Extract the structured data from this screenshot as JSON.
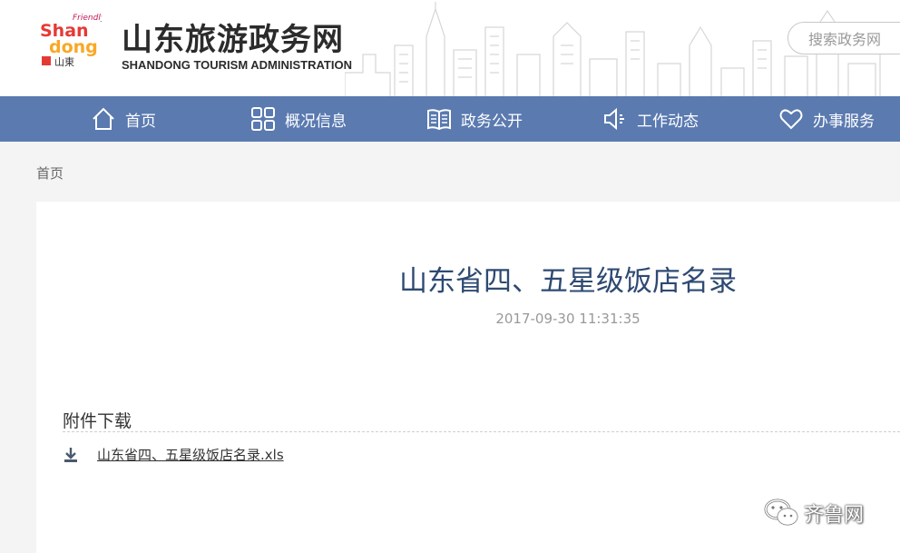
{
  "header": {
    "logo_text": "Shandong",
    "logo_script": "Friendly",
    "site_title": "山东旅游政务网",
    "site_subtitle": "SHANDONG TOURISM ADMINISTRATION",
    "search_placeholder": "搜索政务网"
  },
  "nav": {
    "items": [
      {
        "label": "首页",
        "icon": "home-icon"
      },
      {
        "label": "概况信息",
        "icon": "grid-icon"
      },
      {
        "label": "政务公开",
        "icon": "book-icon"
      },
      {
        "label": "工作动态",
        "icon": "speaker-icon"
      },
      {
        "label": "办事服务",
        "icon": "heart-icon"
      }
    ]
  },
  "breadcrumb": {
    "home": "首页"
  },
  "article": {
    "title": "山东省四、五星级饭店名录",
    "date": "2017-09-30 11:31:35"
  },
  "attachments": {
    "heading": "附件下载",
    "files": [
      {
        "name": "山东省四、五星级饭店名录.xls",
        "icon": "download-icon"
      }
    ]
  },
  "watermark": {
    "text": "齐鲁网",
    "icon": "wechat-icon"
  },
  "colors": {
    "nav_background": "#5a7ab0",
    "title_color": "#2e4a72",
    "page_background": "#f4f4f4"
  }
}
